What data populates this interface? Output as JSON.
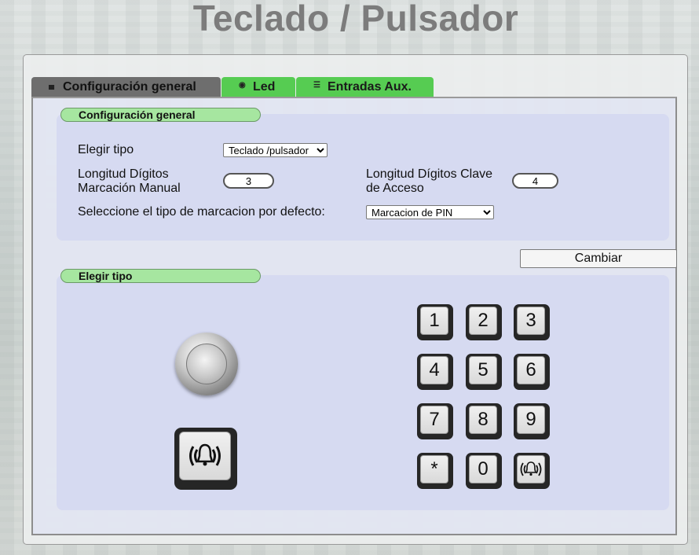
{
  "page": {
    "title": "Teclado / Pulsador"
  },
  "tabs": [
    {
      "label": "Configuración general",
      "icon": "keyboard-icon",
      "active": true
    },
    {
      "label": "Led",
      "icon": "led-icon",
      "active": false
    },
    {
      "label": "Entradas Aux.",
      "icon": "list-icon",
      "active": false
    }
  ],
  "general": {
    "header": "Configuración general",
    "tipo_label": "Elegir tipo",
    "tipo_value": "Teclado /pulsador",
    "long_manual_label_1": "Longitud Dígitos",
    "long_manual_label_2": "Marcación Manual",
    "long_manual_value": "3",
    "long_clave_label_1": "Longitud Dígitos Clave",
    "long_clave_label_2": "de Acceso",
    "long_clave_value": "4",
    "marcacion_label": "Seleccione el tipo de marcacion por defecto:",
    "marcacion_value": "Marcacion de PIN"
  },
  "actions": {
    "cambiar_label": "Cambiar"
  },
  "tipo": {
    "header": "Elegir tipo"
  },
  "keypad": {
    "keys": [
      "1",
      "2",
      "3",
      "4",
      "5",
      "6",
      "7",
      "8",
      "9",
      "*",
      "0",
      "bell"
    ]
  },
  "colors": {
    "tab_active": "#6e6e6e",
    "tab_inactive": "#56cc52",
    "section_header": "#a6e6a0",
    "title": "#7c7c7c"
  }
}
